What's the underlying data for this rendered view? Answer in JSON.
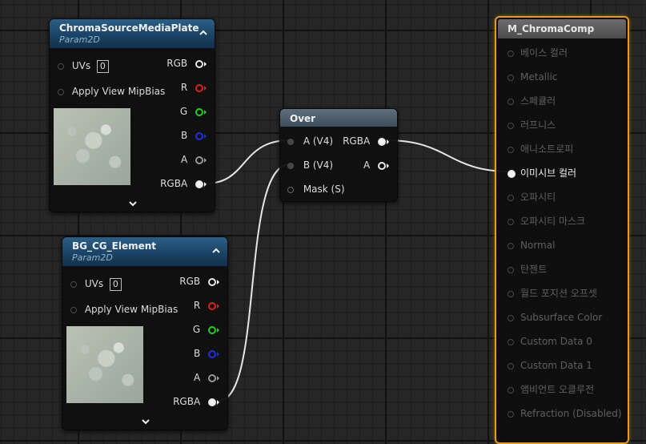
{
  "colors": {
    "header_blue": "#1a4466",
    "material_outline": "#e59b1f",
    "pin_r": "#e02020",
    "pin_g": "#20d020",
    "pin_b": "#2030e0"
  },
  "nodes": {
    "chroma_source": {
      "title": "ChromaSourceMediaPlate",
      "subtitle": "Param2D",
      "uvs_label": "UVs",
      "uvs_value": "0",
      "mip_label": "Apply View MipBias",
      "outputs": [
        "RGB",
        "R",
        "G",
        "B",
        "A",
        "RGBA"
      ]
    },
    "bg_cg": {
      "title": "BG_CG_Element",
      "subtitle": "Param2D",
      "uvs_label": "UVs",
      "uvs_value": "0",
      "mip_label": "Apply View MipBias",
      "outputs": [
        "RGB",
        "R",
        "G",
        "B",
        "A",
        "RGBA"
      ]
    },
    "over": {
      "title": "Over",
      "inputs": [
        "A (V4)",
        "B (V4)",
        "Mask (S)"
      ],
      "outputs": [
        "RGBA",
        "A"
      ]
    },
    "material": {
      "title": "M_ChromaComp",
      "pins": [
        "베이스 컬러",
        "Metallic",
        "스페큘러",
        "러프니스",
        "애니소트로피",
        "이미시브 컬러",
        "오파시티",
        "오파시티 마스크",
        "Normal",
        "탄젠트",
        "월드 포지션 오프셋",
        "Subsurface Color",
        "Custom Data 0",
        "Custom Data 1",
        "앰비언트 오클루전",
        "Refraction (Disabled)"
      ],
      "active_pin": "이미시브 컬러"
    }
  }
}
